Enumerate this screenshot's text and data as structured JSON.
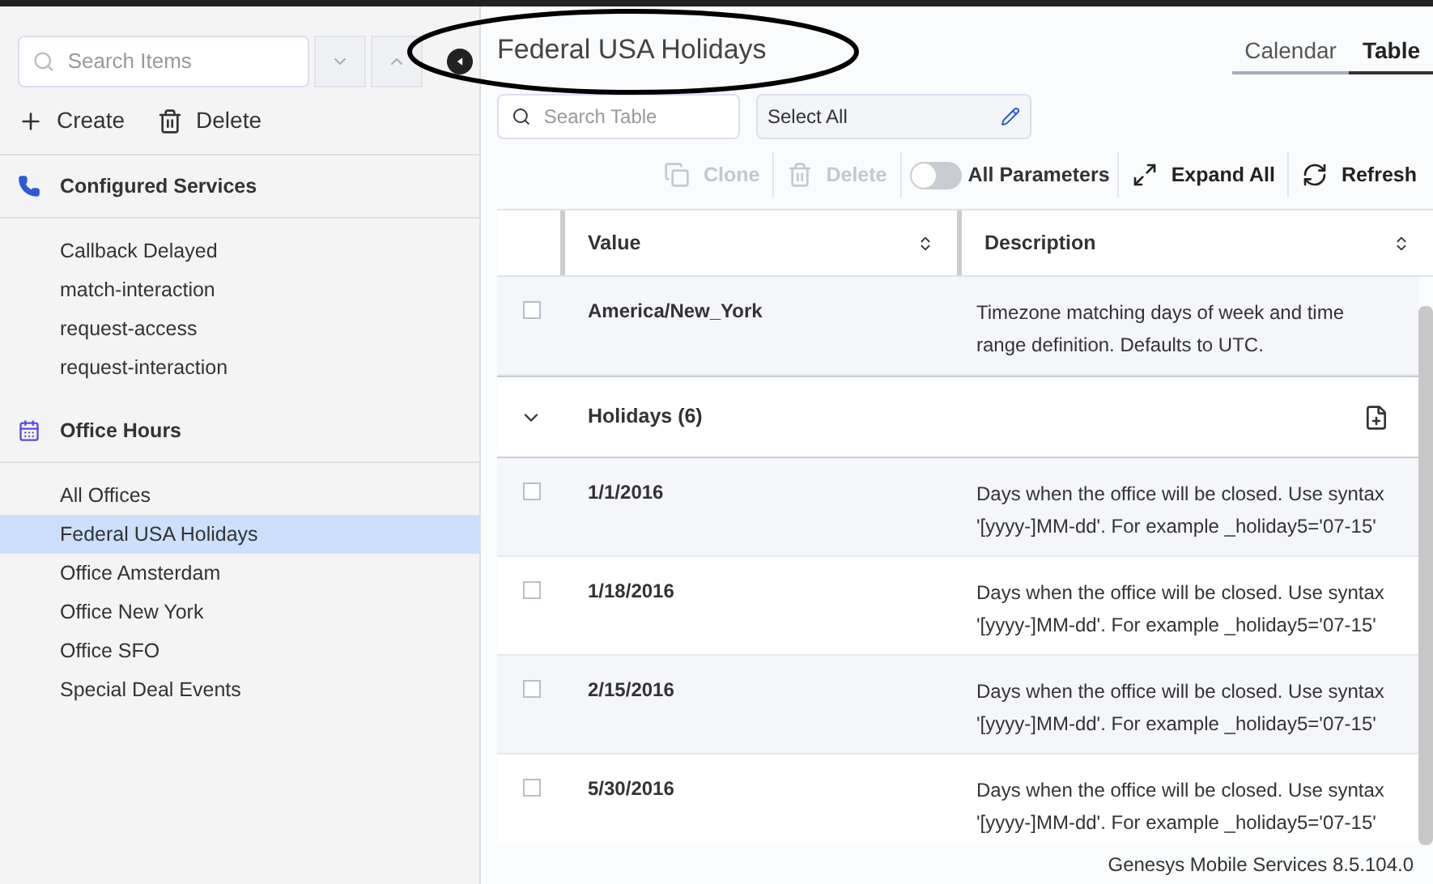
{
  "sidebar": {
    "search": {
      "placeholder": "Search Items"
    },
    "actions": [
      {
        "kind": "create",
        "label": "Create"
      },
      {
        "kind": "delete",
        "label": "Delete"
      }
    ],
    "groups": [
      {
        "kind": "phone",
        "title": "Configured Services",
        "items": [
          {
            "label": "Callback Delayed",
            "selected": false
          },
          {
            "label": "match-interaction",
            "selected": false
          },
          {
            "label": "request-access",
            "selected": false
          },
          {
            "label": "request-interaction",
            "selected": false
          }
        ]
      },
      {
        "kind": "calendar",
        "title": "Office Hours",
        "items": [
          {
            "label": "All Offices",
            "selected": false
          },
          {
            "label": "Federal USA Holidays",
            "selected": true
          },
          {
            "label": "Office Amsterdam",
            "selected": false
          },
          {
            "label": "Office New York",
            "selected": false
          },
          {
            "label": "Office SFO",
            "selected": false
          },
          {
            "label": "Special Deal Events",
            "selected": false
          }
        ]
      }
    ]
  },
  "main": {
    "title": "Federal USA Holidays",
    "view_tabs": [
      {
        "label": "Calendar",
        "selected": false
      },
      {
        "label": "Table",
        "selected": true
      }
    ],
    "search": {
      "placeholder": "Search Table"
    },
    "select": {
      "value": "Select All"
    },
    "toolbar": [
      {
        "kind": "clone",
        "label": "Clone",
        "disabled": true
      },
      {
        "kind": "delete",
        "label": "Delete",
        "disabled": true
      },
      {
        "kind": "toggle",
        "label": "All Parameters",
        "on": false
      },
      {
        "kind": "expand",
        "label": "Expand All",
        "disabled": false
      },
      {
        "kind": "refresh",
        "label": "Refresh",
        "disabled": false
      }
    ],
    "table": {
      "columns": [
        "Value",
        "Description"
      ],
      "rows": [
        {
          "kind": "row",
          "value": "America/New_York",
          "description": "Timezone matching days of week and time range definition. Defaults to UTC.",
          "checked": false
        },
        {
          "kind": "group",
          "value": "Holidays (6)",
          "expanded": true
        },
        {
          "kind": "row",
          "value": "1/1/2016",
          "description": "Days when the office will be closed. Use syntax '[yyyy-]MM-dd'. For example _holiday5='07-15'",
          "checked": false
        },
        {
          "kind": "row",
          "value": "1/18/2016",
          "description": "Days when the office will be closed. Use syntax '[yyyy-]MM-dd'. For example _holiday5='07-15'",
          "checked": false
        },
        {
          "kind": "row",
          "value": "2/15/2016",
          "description": "Days when the office will be closed. Use syntax '[yyyy-]MM-dd'. For example _holiday5='07-15'",
          "checked": false
        },
        {
          "kind": "row",
          "value": "5/30/2016",
          "description": "Days when the office will be closed. Use syntax '[yyyy-]MM-dd'. For example _holiday5='07-15'",
          "checked": false
        }
      ]
    },
    "footer": "Genesys Mobile Services 8.5.104.0"
  }
}
